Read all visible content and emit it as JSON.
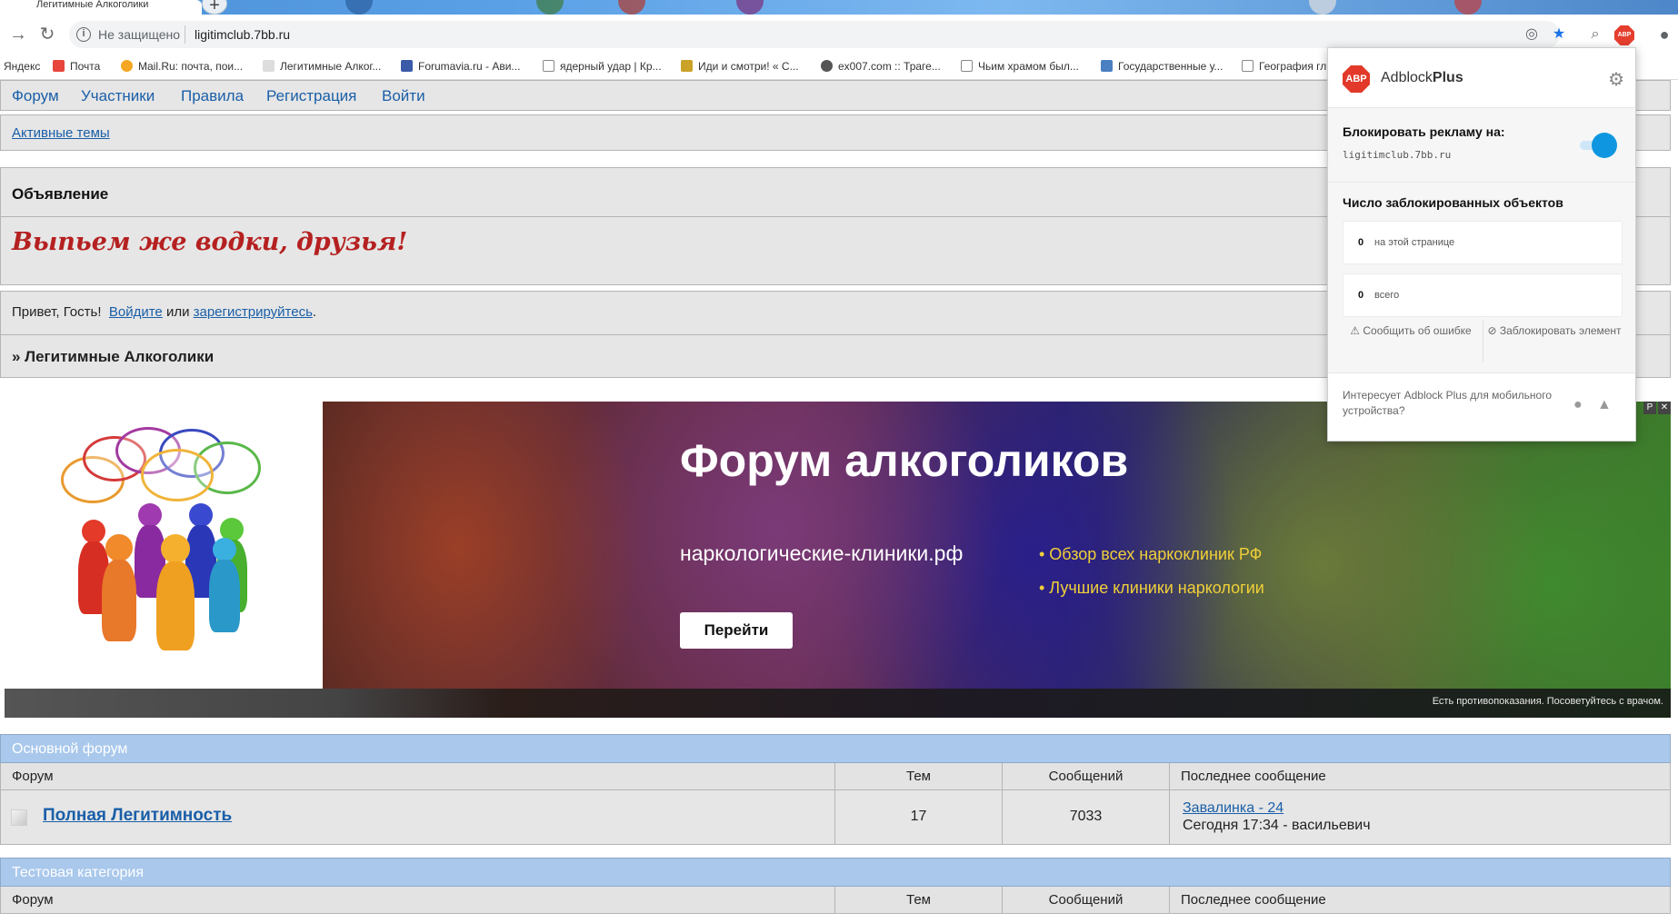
{
  "browser": {
    "tab_title": "Легитимные Алкоголики",
    "security_label": "Не защищено",
    "url": "ligitimclub.7bb.ru",
    "bookmarks": [
      {
        "label": "Яндекс",
        "color": "#ffffff"
      },
      {
        "label": "Почта",
        "color": "#e8453c"
      },
      {
        "label": "Mail.Ru: почта, пои...",
        "color": "#f5a623"
      },
      {
        "label": "Легитимные Алког...",
        "color": "#e0e0e0"
      },
      {
        "label": "Forumavia.ru - Ави...",
        "color": "#3b5ba8"
      },
      {
        "label": "ядерный удар | Кр...",
        "color": "#ffffff"
      },
      {
        "label": "Иди и смотри! « С...",
        "color": "#c9a227"
      },
      {
        "label": "ex007.com :: Траге...",
        "color": "#555555"
      },
      {
        "label": "Чьим храмом был...",
        "color": "#ffffff"
      },
      {
        "label": "Государственные у...",
        "color": "#4a7fc1"
      },
      {
        "label": "География гл",
        "color": "#ffffff"
      }
    ]
  },
  "forum": {
    "menu": [
      "Форум",
      "Участники",
      "Правила",
      "Регистрация",
      "Войти"
    ],
    "active_topics": "Активные темы",
    "announcement_title": "Объявление",
    "announcement_text": "Выпьем же водки, друзья!",
    "greeting_prefix": "Привет, Гость!",
    "login_link": "Войдите",
    "or_text": "или",
    "register_link": "зарегистрируйтесь",
    "period": ".",
    "breadcrumb": "» Легитимные Алкоголики"
  },
  "ad": {
    "title": "Форум алкоголиков",
    "site": "наркологические-клиники.рф",
    "bullets": [
      "• Обзор всех наркоклиник РФ",
      "• Лучшие клиники наркологии"
    ],
    "button": "Перейти",
    "disclaimer": "Есть противопоказания. Посоветуйтесь с врачом.",
    "mark_p": "Р",
    "mark_close": "✕"
  },
  "categories": [
    {
      "name": "Основной форум",
      "headers": [
        "Форум",
        "Тем",
        "Сообщений",
        "Последнее сообщение"
      ],
      "rows": [
        {
          "forum": "Полная Легитимность",
          "topics": "17",
          "posts": "7033",
          "last_topic": "Завалинка - 24",
          "last_info": "Сегодня 17:34 - васильевич"
        }
      ]
    },
    {
      "name": "Тестовая категория",
      "headers": [
        "Форум",
        "Тем",
        "Сообщений",
        "Последнее сообщение"
      ]
    }
  ],
  "adblock": {
    "brand_regular": "Adblock",
    "brand_bold": "Plus",
    "logo_text": "ABP",
    "block_label": "Блокировать рекламу на:",
    "domain": "ligitimclub.7bb.ru",
    "toggle_on": true,
    "stats_title": "Число заблокированных объектов",
    "page_count": "0",
    "page_label": "на этой странице",
    "total_count": "0",
    "total_label": "всего",
    "report_label": "Сообщить об ошибке",
    "block_element_label": "Заблокировать элемент",
    "mobile_text": "Интересует Adblock Plus для мобильного устройства?",
    "accent_color": "#0e97e0"
  }
}
